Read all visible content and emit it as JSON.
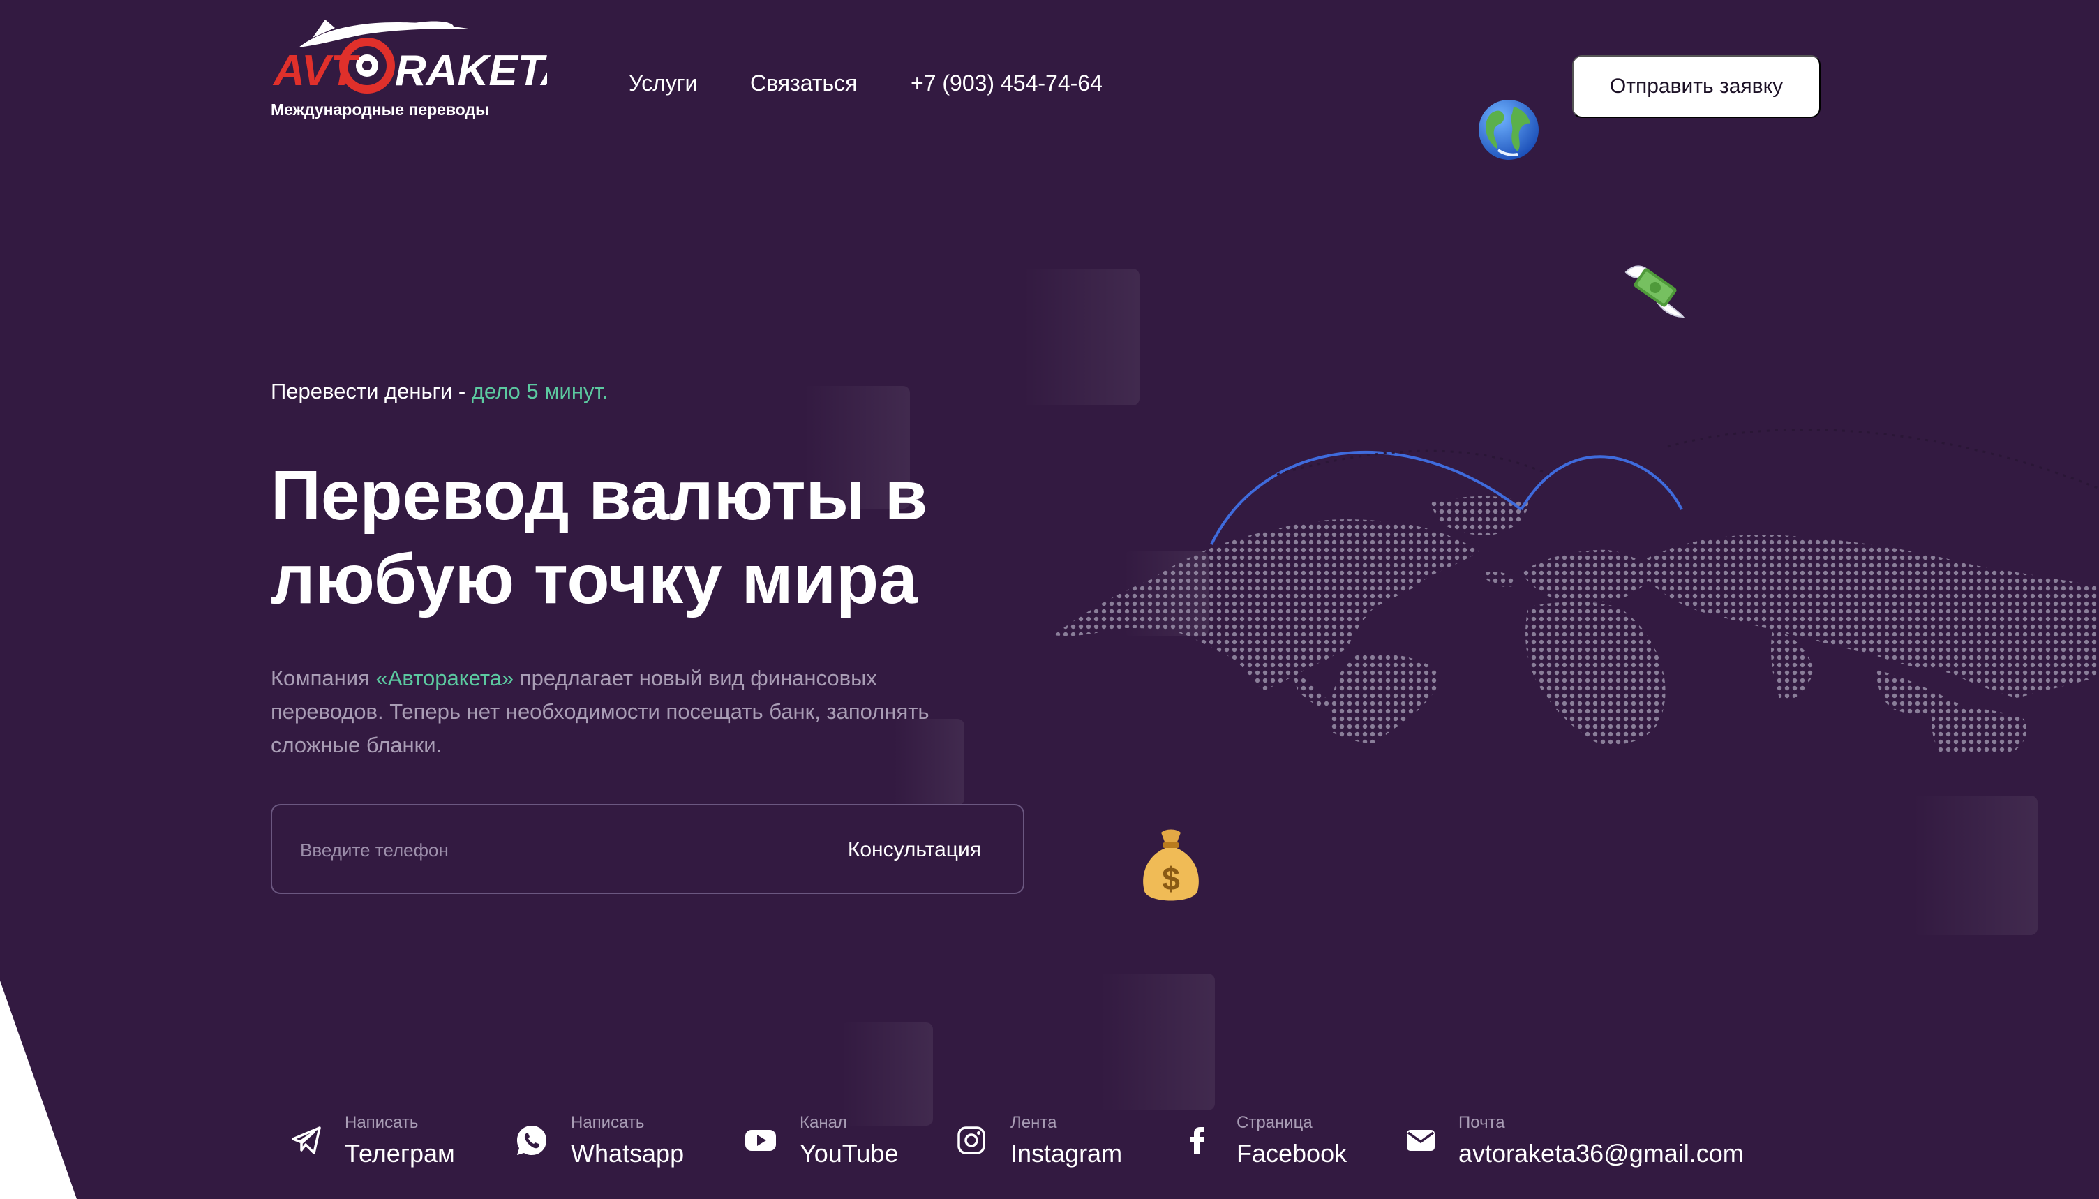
{
  "brand": {
    "logo_prefix": "AVT",
    "logo_suffix": "RAKETA",
    "subtitle": "Международные переводы",
    "colors": {
      "red": "#e0302b",
      "accent": "#5cc9a0",
      "background": "#331a41"
    }
  },
  "nav": {
    "services": "Услуги",
    "contact": "Связаться",
    "phone": "+7 (903) 454-74-64"
  },
  "header": {
    "cta_label": "Отправить заявку"
  },
  "icons": {
    "globe": "globe-emoji",
    "money_wings": "money-with-wings-emoji",
    "money_bag": "money-bag-emoji"
  },
  "hero": {
    "tagline_main": "Перевести деньги - ",
    "tagline_accent": "дело 5 минут.",
    "title_line1": "Перевод валюты в",
    "title_line2": "любую точку мира",
    "desc_before": "Компания ",
    "desc_brand": "«Авторакета»",
    "desc_after": " предлагает новый вид финансовых переводов. Теперь нет необходимости посещать банк, заполнять сложные бланки."
  },
  "form": {
    "phone_placeholder": "Введите телефон",
    "phone_value": "",
    "submit_label": "Консультация"
  },
  "socials": [
    {
      "icon": "telegram-icon",
      "small": "Написать",
      "big": "Телеграм"
    },
    {
      "icon": "whatsapp-icon",
      "small": "Написать",
      "big": "Whatsapp"
    },
    {
      "icon": "youtube-icon",
      "small": "Канал",
      "big": "YouTube"
    },
    {
      "icon": "instagram-icon",
      "small": "Лента",
      "big": "Instagram"
    },
    {
      "icon": "facebook-icon",
      "small": "Страница",
      "big": "Facebook"
    },
    {
      "icon": "mail-icon",
      "small": "Почта",
      "big": "avtoraketa36@gmail.com"
    }
  ]
}
